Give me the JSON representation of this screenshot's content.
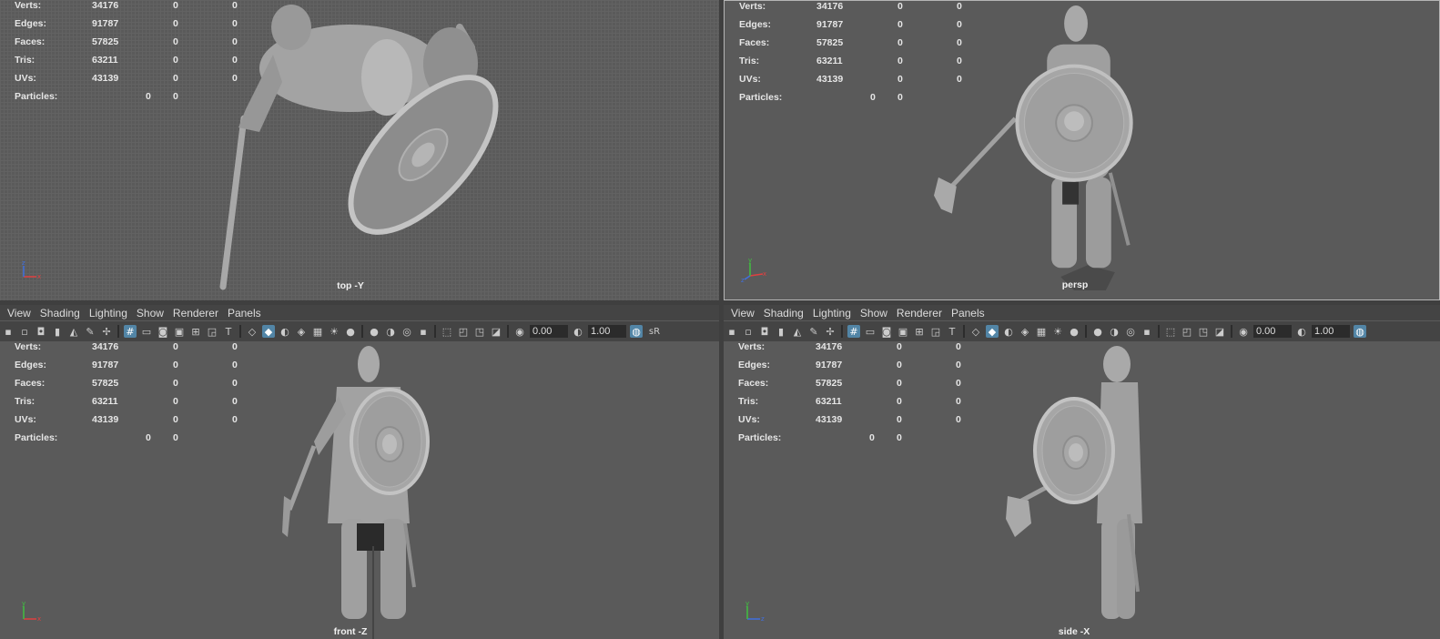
{
  "menu": [
    "View",
    "Shading",
    "Lighting",
    "Show",
    "Renderer",
    "Panels"
  ],
  "toolbar": {
    "value_a": "0.00",
    "value_b": "1.00",
    "srgb_label": "sR"
  },
  "hud": {
    "labels": [
      "Verts:",
      "Edges:",
      "Faces:",
      "Tris:",
      "UVs:",
      "Particles:"
    ],
    "verts": [
      "34176",
      "0",
      "0"
    ],
    "edges": [
      "91787",
      "0",
      "0"
    ],
    "faces": [
      "57825",
      "0",
      "0"
    ],
    "tris": [
      "63211",
      "0",
      "0"
    ],
    "uvs": [
      "43139",
      "0",
      "0"
    ],
    "particles": [
      "0",
      "0"
    ]
  },
  "panes": {
    "top": {
      "camera": "top -Y"
    },
    "persp": {
      "camera": "persp"
    },
    "front": {
      "camera": "front -Z"
    },
    "side": {
      "camera": "side -X"
    }
  },
  "colors": {
    "viewport_bg": "#5a5a5a",
    "menubar_bg": "#444444",
    "toolbar_active": "#5285a6",
    "hud_text": "#e6e6e6"
  }
}
